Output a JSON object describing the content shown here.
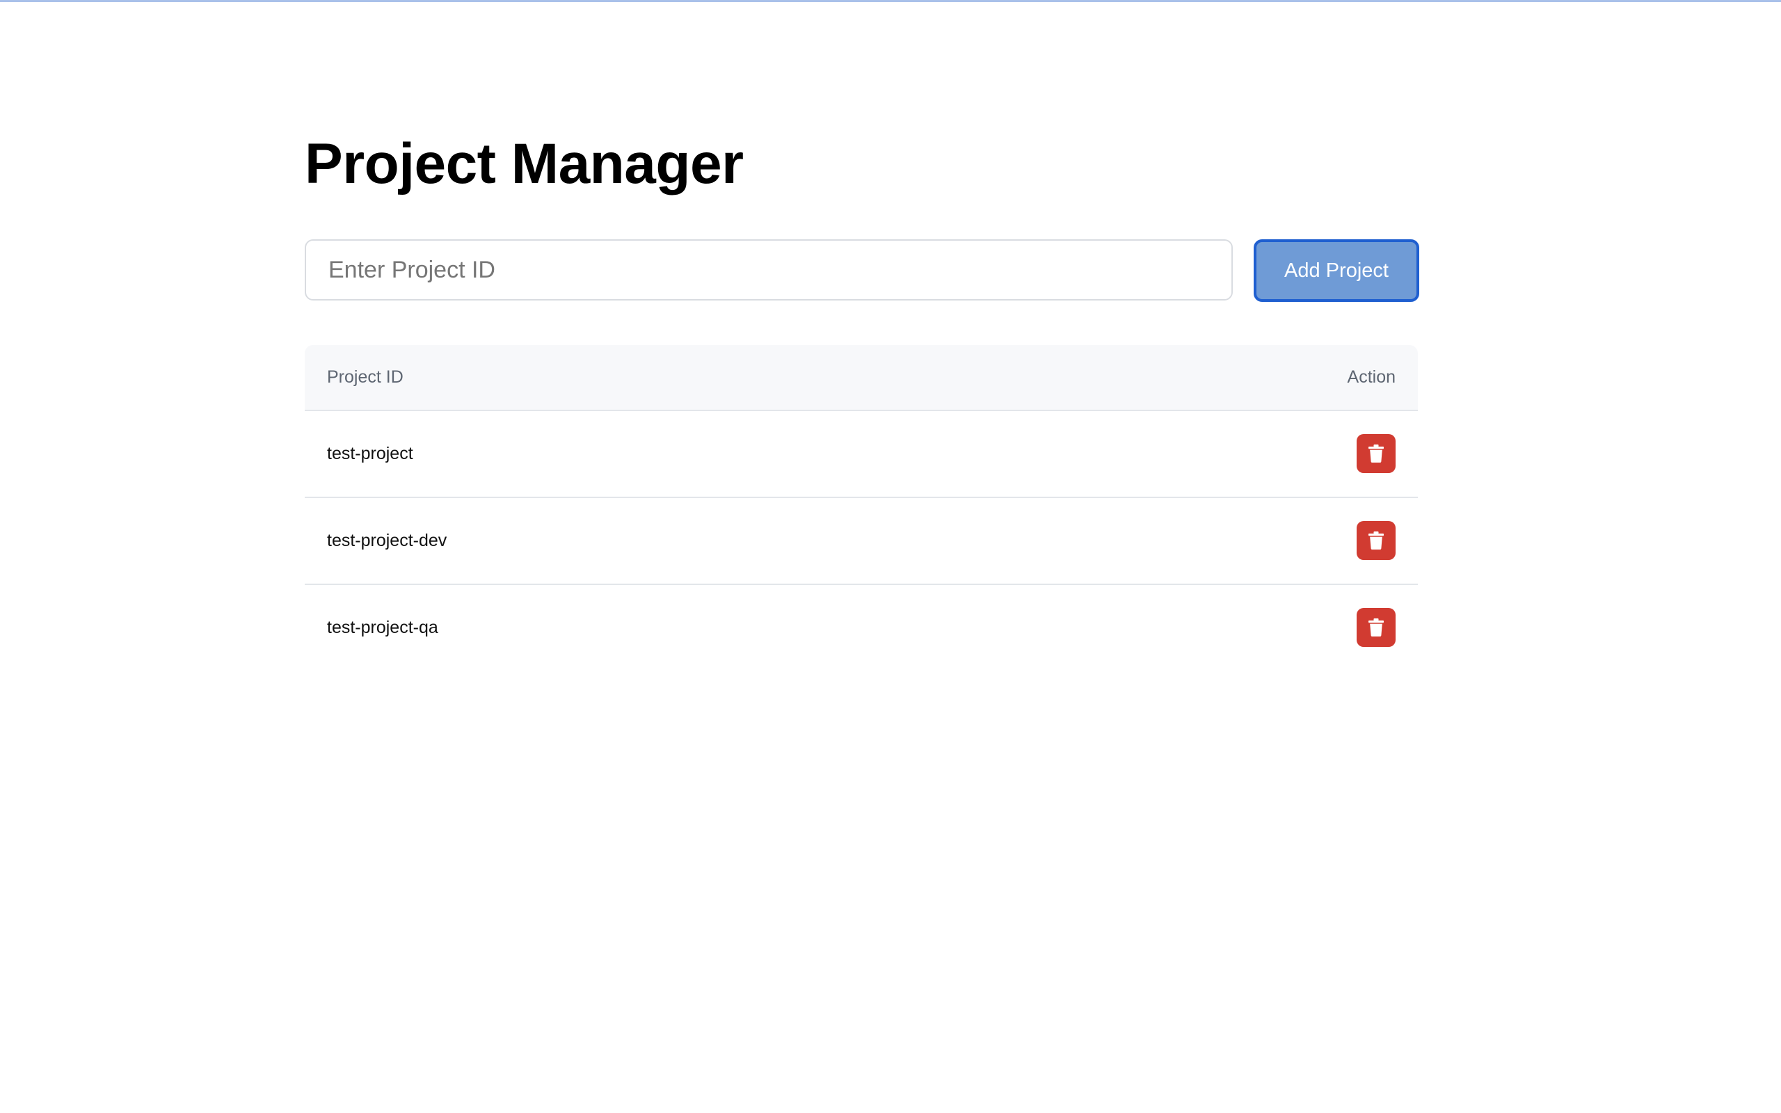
{
  "page": {
    "title": "Project Manager"
  },
  "form": {
    "input_value": "",
    "input_placeholder": "Enter Project ID",
    "add_button_label": "Add Project"
  },
  "table": {
    "headers": {
      "project_id": "Project ID",
      "action": "Action"
    },
    "rows": [
      {
        "project_id": "test-project",
        "action_icon": "trash-icon"
      },
      {
        "project_id": "test-project-dev",
        "action_icon": "trash-icon"
      },
      {
        "project_id": "test-project-qa",
        "action_icon": "trash-icon"
      }
    ]
  },
  "colors": {
    "accent": "#6f9bd6",
    "accent_border": "#1f5fd0",
    "danger": "#d13b31",
    "header_bg": "#f7f8fa"
  }
}
